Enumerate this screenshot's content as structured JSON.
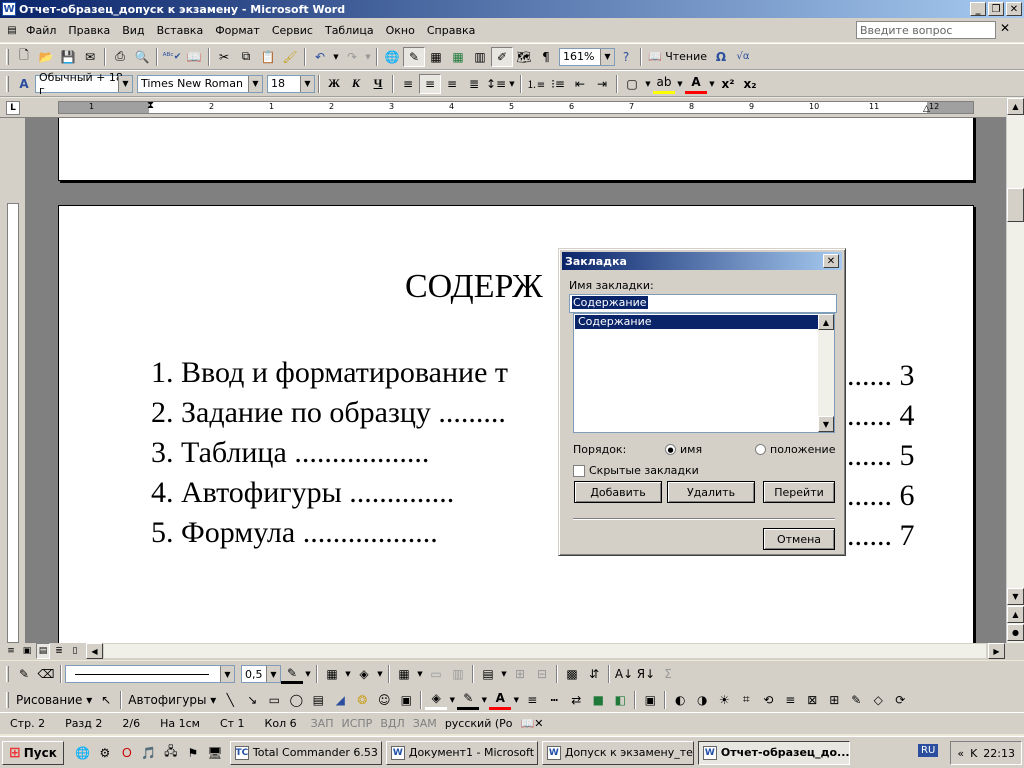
{
  "window": {
    "title": "Отчет-образец_допуск к экзамену - Microsoft Word",
    "app_icon": "W"
  },
  "menu": {
    "items": [
      "Файл",
      "Правка",
      "Вид",
      "Вставка",
      "Формат",
      "Сервис",
      "Таблица",
      "Окно",
      "Справка"
    ],
    "ask_placeholder": "Введите вопрос"
  },
  "standard_toolbar": {
    "zoom": "161%",
    "reading_label": "Чтение"
  },
  "formatting_toolbar": {
    "style": "Обычный + 18 г",
    "font": "Times New Roman",
    "size": "18"
  },
  "ruler": {
    "numbers": [
      "1",
      "2",
      "1",
      "2",
      "3",
      "4",
      "5",
      "6",
      "7",
      "8",
      "9",
      "10",
      "11",
      "12",
      "13"
    ]
  },
  "document": {
    "heading": "СОДЕРЖ",
    "toc": [
      {
        "text": "1. Ввод и форматирование т",
        "page": "3"
      },
      {
        "text": "2. Задание по образцу",
        "page": "4"
      },
      {
        "text": "3. Таблица",
        "page": "5"
      },
      {
        "text": "4. Автофигуры",
        "page": "6"
      },
      {
        "text": "5. Формула",
        "page": "7"
      }
    ]
  },
  "dialog": {
    "title": "Закладка",
    "name_label": "Имя закладки:",
    "name_value": "Содержание",
    "list_items": [
      "Содержание"
    ],
    "order_label": "Порядок:",
    "order_name": "имя",
    "order_position": "положение",
    "hidden_label": "Скрытые закладки",
    "add_label": "Добавить",
    "delete_label": "Удалить",
    "goto_label": "Перейти",
    "cancel_label": "Отмена"
  },
  "drawing_toolbar": {
    "line_width": "0,5",
    "drawing_label": "Рисование",
    "autoshapes_label": "Автофигуры"
  },
  "status": {
    "page": "Стр. 2",
    "section": "Разд 2",
    "pages": "2/6",
    "at": "На 1см",
    "line": "Ст 1",
    "col": "Кол 6",
    "rec": "ЗАП",
    "trk": "ИСПР",
    "ext": "ВДЛ",
    "ovr": "ЗАМ",
    "lang": "русский (Ро"
  },
  "taskbar": {
    "start": "Пуск",
    "tasks": [
      {
        "label": "Total Commander 6.53 ...",
        "icon": "TC",
        "active": false
      },
      {
        "label": "Документ1 - Microsoft ...",
        "icon": "W",
        "active": false
      },
      {
        "label": "Допуск к экзамену_те...",
        "icon": "W",
        "active": false
      },
      {
        "label": "Отчет-образец_до...",
        "icon": "W",
        "active": true
      }
    ],
    "lang": "RU",
    "time": "22:13"
  },
  "colors": {
    "titlebar_start": "#0A246A",
    "titlebar_end": "#A6CAF0",
    "face": "#D4D0C8",
    "selection": "#0A246A"
  }
}
